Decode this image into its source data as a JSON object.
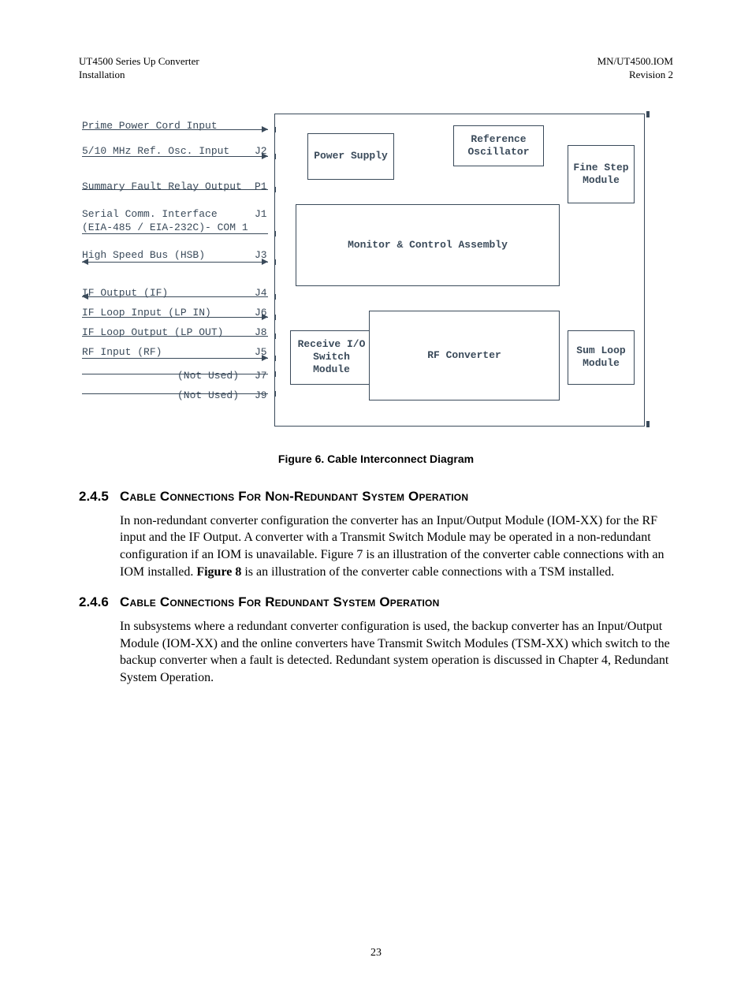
{
  "header": {
    "left_line1": "UT4500 Series Up Converter",
    "left_line2": "Installation",
    "right_line1": "MN/UT4500.IOM",
    "right_line2": "Revision 2"
  },
  "diagram": {
    "signals": [
      {
        "label": "Prime Power Cord Input",
        "port": "",
        "dir": "right"
      },
      {
        "label": "5/10 MHz Ref. Osc. Input",
        "port": "J2",
        "dir": "right"
      },
      {
        "label": "Summary Fault Relay Output",
        "port": "P1",
        "dir": "none"
      },
      {
        "label": "Serial Comm. Interface",
        "port": "J1",
        "dir": "none"
      },
      {
        "label": "(EIA-485 / EIA-232C)- COM 1",
        "port": "",
        "dir": "both"
      },
      {
        "label": "High Speed Bus (HSB)",
        "port": "J3",
        "dir": "both"
      },
      {
        "label": "IF Output (IF)",
        "port": "J4",
        "dir": "left"
      },
      {
        "label": "IF Loop Input (LP IN)",
        "port": "J6",
        "dir": "right"
      },
      {
        "label": "IF Loop Output (LP OUT)",
        "port": "J8",
        "dir": "none"
      },
      {
        "label": "RF Input (RF)",
        "port": "J5",
        "dir": "right"
      },
      {
        "label": "(Not Used)",
        "port": "J7",
        "dir": "none"
      },
      {
        "label": "(Not Used)",
        "port": "J9",
        "dir": "none"
      }
    ],
    "boxes": {
      "power_supply": "Power\nSupply",
      "reference_oscillator": "Reference\nOscillator",
      "fine_step": "Fine\nStep\nModule",
      "monitor_control": "Monitor & Control Assembly",
      "receive_io": "Receive\nI/O Switch\nModule",
      "rf_converter": "RF Converter",
      "sum_loop": "Sum\nLoop\nModule"
    }
  },
  "figure_caption": "Figure 6.  Cable Interconnect Diagram",
  "section_245": {
    "num": "2.4.5",
    "title": "Cable Connections For Non-Redundant System Operation",
    "body_part1": "In non-redundant converter configuration the converter has an Input/Output Module (IOM-XX) for the RF input and the IF Output.  A converter with a Transmit Switch Module may be operated in a non-redundant configuration if an IOM is unavailable. Figure 7 is an illustration of the converter cable connections with an IOM installed. ",
    "body_bold": "Figure 8",
    "body_part2": " is an illustration of the converter cable connections with a TSM installed."
  },
  "section_246": {
    "num": "2.4.6",
    "title": "Cable Connections For Redundant System Operation",
    "body": "In subsystems where a redundant converter configuration is used, the backup converter has an Input/Output Module (IOM-XX) and the online converters have Transmit Switch Modules (TSM-XX) which switch to the backup converter when a fault is detected. Redundant system operation is discussed in Chapter 4, Redundant System Operation."
  },
  "page_number": "23"
}
